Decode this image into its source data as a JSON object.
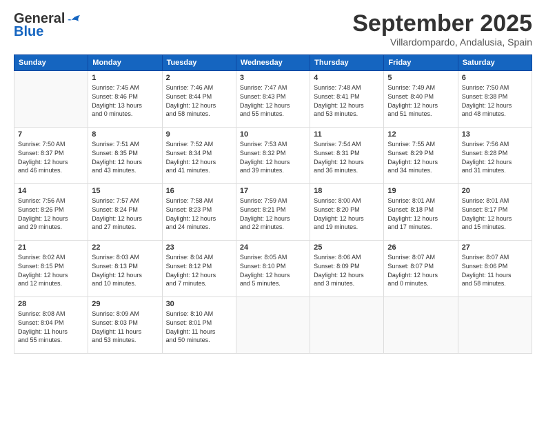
{
  "logo": {
    "line1": "General",
    "line2": "Blue"
  },
  "header": {
    "month": "September 2025",
    "location": "Villardompardo, Andalusia, Spain"
  },
  "days_of_week": [
    "Sunday",
    "Monday",
    "Tuesday",
    "Wednesday",
    "Thursday",
    "Friday",
    "Saturday"
  ],
  "weeks": [
    [
      {
        "day": "",
        "info": ""
      },
      {
        "day": "1",
        "info": "Sunrise: 7:45 AM\nSunset: 8:46 PM\nDaylight: 13 hours\nand 0 minutes."
      },
      {
        "day": "2",
        "info": "Sunrise: 7:46 AM\nSunset: 8:44 PM\nDaylight: 12 hours\nand 58 minutes."
      },
      {
        "day": "3",
        "info": "Sunrise: 7:47 AM\nSunset: 8:43 PM\nDaylight: 12 hours\nand 55 minutes."
      },
      {
        "day": "4",
        "info": "Sunrise: 7:48 AM\nSunset: 8:41 PM\nDaylight: 12 hours\nand 53 minutes."
      },
      {
        "day": "5",
        "info": "Sunrise: 7:49 AM\nSunset: 8:40 PM\nDaylight: 12 hours\nand 51 minutes."
      },
      {
        "day": "6",
        "info": "Sunrise: 7:50 AM\nSunset: 8:38 PM\nDaylight: 12 hours\nand 48 minutes."
      }
    ],
    [
      {
        "day": "7",
        "info": "Sunrise: 7:50 AM\nSunset: 8:37 PM\nDaylight: 12 hours\nand 46 minutes."
      },
      {
        "day": "8",
        "info": "Sunrise: 7:51 AM\nSunset: 8:35 PM\nDaylight: 12 hours\nand 43 minutes."
      },
      {
        "day": "9",
        "info": "Sunrise: 7:52 AM\nSunset: 8:34 PM\nDaylight: 12 hours\nand 41 minutes."
      },
      {
        "day": "10",
        "info": "Sunrise: 7:53 AM\nSunset: 8:32 PM\nDaylight: 12 hours\nand 39 minutes."
      },
      {
        "day": "11",
        "info": "Sunrise: 7:54 AM\nSunset: 8:31 PM\nDaylight: 12 hours\nand 36 minutes."
      },
      {
        "day": "12",
        "info": "Sunrise: 7:55 AM\nSunset: 8:29 PM\nDaylight: 12 hours\nand 34 minutes."
      },
      {
        "day": "13",
        "info": "Sunrise: 7:56 AM\nSunset: 8:28 PM\nDaylight: 12 hours\nand 31 minutes."
      }
    ],
    [
      {
        "day": "14",
        "info": "Sunrise: 7:56 AM\nSunset: 8:26 PM\nDaylight: 12 hours\nand 29 minutes."
      },
      {
        "day": "15",
        "info": "Sunrise: 7:57 AM\nSunset: 8:24 PM\nDaylight: 12 hours\nand 27 minutes."
      },
      {
        "day": "16",
        "info": "Sunrise: 7:58 AM\nSunset: 8:23 PM\nDaylight: 12 hours\nand 24 minutes."
      },
      {
        "day": "17",
        "info": "Sunrise: 7:59 AM\nSunset: 8:21 PM\nDaylight: 12 hours\nand 22 minutes."
      },
      {
        "day": "18",
        "info": "Sunrise: 8:00 AM\nSunset: 8:20 PM\nDaylight: 12 hours\nand 19 minutes."
      },
      {
        "day": "19",
        "info": "Sunrise: 8:01 AM\nSunset: 8:18 PM\nDaylight: 12 hours\nand 17 minutes."
      },
      {
        "day": "20",
        "info": "Sunrise: 8:01 AM\nSunset: 8:17 PM\nDaylight: 12 hours\nand 15 minutes."
      }
    ],
    [
      {
        "day": "21",
        "info": "Sunrise: 8:02 AM\nSunset: 8:15 PM\nDaylight: 12 hours\nand 12 minutes."
      },
      {
        "day": "22",
        "info": "Sunrise: 8:03 AM\nSunset: 8:13 PM\nDaylight: 12 hours\nand 10 minutes."
      },
      {
        "day": "23",
        "info": "Sunrise: 8:04 AM\nSunset: 8:12 PM\nDaylight: 12 hours\nand 7 minutes."
      },
      {
        "day": "24",
        "info": "Sunrise: 8:05 AM\nSunset: 8:10 PM\nDaylight: 12 hours\nand 5 minutes."
      },
      {
        "day": "25",
        "info": "Sunrise: 8:06 AM\nSunset: 8:09 PM\nDaylight: 12 hours\nand 3 minutes."
      },
      {
        "day": "26",
        "info": "Sunrise: 8:07 AM\nSunset: 8:07 PM\nDaylight: 12 hours\nand 0 minutes."
      },
      {
        "day": "27",
        "info": "Sunrise: 8:07 AM\nSunset: 8:06 PM\nDaylight: 11 hours\nand 58 minutes."
      }
    ],
    [
      {
        "day": "28",
        "info": "Sunrise: 8:08 AM\nSunset: 8:04 PM\nDaylight: 11 hours\nand 55 minutes."
      },
      {
        "day": "29",
        "info": "Sunrise: 8:09 AM\nSunset: 8:03 PM\nDaylight: 11 hours\nand 53 minutes."
      },
      {
        "day": "30",
        "info": "Sunrise: 8:10 AM\nSunset: 8:01 PM\nDaylight: 11 hours\nand 50 minutes."
      },
      {
        "day": "",
        "info": ""
      },
      {
        "day": "",
        "info": ""
      },
      {
        "day": "",
        "info": ""
      },
      {
        "day": "",
        "info": ""
      }
    ]
  ]
}
